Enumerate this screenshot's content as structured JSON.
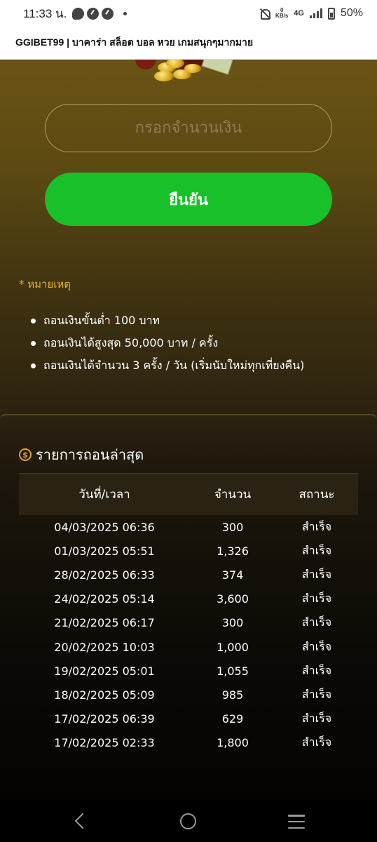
{
  "status_bar": {
    "time": "11:33 น.",
    "data_rate_value": "0",
    "data_rate_unit": "KB/s",
    "network": "4G",
    "battery": "50%"
  },
  "header": {
    "title": "GGIBET99 | บาคาร่า สล็อต บอล หวย เกมสนุกๆมากมาย"
  },
  "withdraw_form": {
    "amount_placeholder": "กรอกจำนวนเงิน",
    "confirm_label": "ยืนยัน",
    "confirm_color": "#18c12a"
  },
  "notes": {
    "title": "* หมายเหตุ",
    "items": [
      "ถอนเงินขั้นต่ำ 100 บาท",
      "ถอนเงินได้สูงสุด 50,000 บาท / ครั้ง",
      "ถอนเงินได้จำนวน 3 ครั้ง / วัน (เริ่มนับใหม่ทุกเที่ยงคืน)"
    ]
  },
  "history": {
    "title": "รายการถอนล่าสุด",
    "icon": "dollar-coin-icon",
    "columns": [
      "วันที่/เวลา",
      "จำนวน",
      "สถานะ"
    ],
    "rows": [
      {
        "datetime": "04/03/2025 06:36",
        "amount": "300",
        "status": "สำเร็จ"
      },
      {
        "datetime": "01/03/2025 05:51",
        "amount": "1,326",
        "status": "สำเร็จ"
      },
      {
        "datetime": "28/02/2025 06:33",
        "amount": "374",
        "status": "สำเร็จ"
      },
      {
        "datetime": "24/02/2025 05:14",
        "amount": "3,600",
        "status": "สำเร็จ"
      },
      {
        "datetime": "21/02/2025 06:17",
        "amount": "300",
        "status": "สำเร็จ"
      },
      {
        "datetime": "20/02/2025 10:03",
        "amount": "1,000",
        "status": "สำเร็จ"
      },
      {
        "datetime": "19/02/2025 05:01",
        "amount": "1,055",
        "status": "สำเร็จ"
      },
      {
        "datetime": "18/02/2025 05:09",
        "amount": "985",
        "status": "สำเร็จ"
      },
      {
        "datetime": "17/02/2025 06:39",
        "amount": "629",
        "status": "สำเร็จ"
      },
      {
        "datetime": "17/02/2025 02:33",
        "amount": "1,800",
        "status": "สำเร็จ"
      }
    ]
  },
  "nav": {
    "icons": [
      "back-icon",
      "home-icon",
      "recents-icon"
    ]
  }
}
